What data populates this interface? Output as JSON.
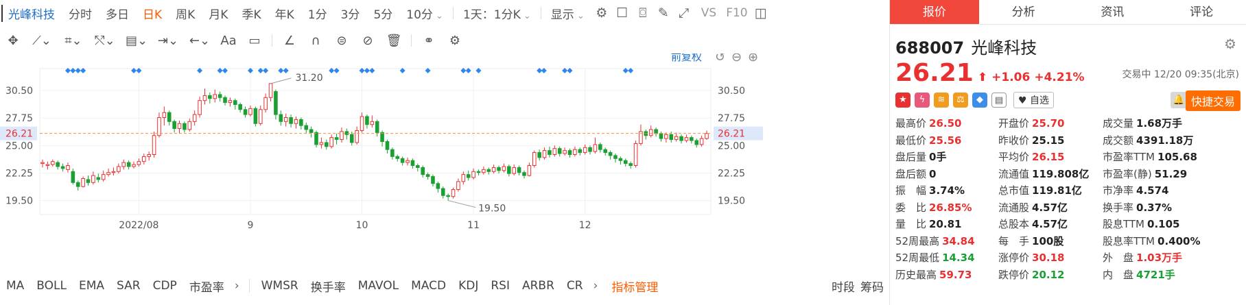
{
  "toolbar": {
    "stock_name": "光峰科技",
    "periods": [
      "分时",
      "多日",
      "日K",
      "周K",
      "月K",
      "季K",
      "年K",
      "1分",
      "3分",
      "5分",
      "10分"
    ],
    "active_period": "日K",
    "multi_select": "1天：1分K",
    "display_label": "显示",
    "vs_label": "VS",
    "f10_label": "F10"
  },
  "chart": {
    "adjust_label": "前复权",
    "current_price_label": "26.21",
    "high_marker": "31.20",
    "low_marker": "19.50",
    "y_ticks": [
      "30.50",
      "27.75",
      "25.00",
      "22.25",
      "19.50"
    ],
    "x_labels": [
      "2022/08",
      "9",
      "10",
      "11",
      "12"
    ]
  },
  "chart_data": {
    "type": "candlestick",
    "y_ticks": [
      30.5,
      27.75,
      25.0,
      22.25,
      19.5
    ],
    "current_price": 26.21,
    "high": 31.2,
    "low": 19.5,
    "x_labels": [
      "2022/08",
      "9",
      "10",
      "11",
      "12"
    ],
    "candles": [
      [
        23.2,
        23.3,
        22.8,
        23.6
      ],
      [
        23.0,
        23.1,
        22.6,
        23.4
      ],
      [
        23.1,
        23.4,
        22.9,
        23.6
      ],
      [
        23.3,
        22.9,
        22.6,
        23.5
      ],
      [
        22.9,
        22.7,
        22.4,
        23.2
      ],
      [
        22.6,
        23.0,
        22.3,
        23.3
      ],
      [
        22.4,
        21.3,
        21.1,
        22.7
      ],
      [
        21.3,
        20.9,
        20.5,
        21.5
      ],
      [
        20.9,
        21.7,
        20.8,
        21.9
      ],
      [
        21.6,
        21.3,
        21.0,
        22.0
      ],
      [
        21.3,
        22.0,
        21.1,
        22.4
      ],
      [
        21.8,
        21.6,
        21.3,
        22.2
      ],
      [
        21.6,
        22.1,
        21.4,
        22.5
      ],
      [
        22.1,
        22.3,
        21.9,
        22.7
      ],
      [
        22.3,
        22.4,
        22.0,
        22.8
      ],
      [
        22.4,
        22.9,
        22.2,
        23.2
      ],
      [
        22.9,
        23.3,
        22.6,
        23.6
      ],
      [
        23.3,
        22.9,
        22.6,
        23.5
      ],
      [
        22.9,
        23.1,
        22.7,
        23.4
      ],
      [
        23.1,
        23.4,
        22.9,
        23.7
      ],
      [
        23.4,
        23.9,
        23.1,
        24.2
      ],
      [
        23.9,
        24.1,
        23.5,
        24.4
      ],
      [
        24.1,
        26.0,
        23.8,
        26.4
      ],
      [
        26.0,
        27.8,
        25.8,
        28.3
      ],
      [
        27.8,
        28.3,
        27.0,
        28.9
      ],
      [
        28.3,
        27.4,
        27.0,
        28.5
      ],
      [
        27.4,
        26.7,
        26.3,
        27.6
      ],
      [
        26.7,
        27.2,
        26.2,
        27.5
      ],
      [
        27.2,
        26.6,
        26.3,
        27.4
      ],
      [
        26.6,
        27.4,
        26.4,
        27.7
      ],
      [
        27.4,
        28.1,
        27.0,
        28.5
      ],
      [
        28.1,
        29.5,
        27.8,
        29.9
      ],
      [
        29.5,
        30.0,
        29.1,
        30.7
      ],
      [
        30.0,
        29.7,
        29.2,
        30.3
      ],
      [
        29.7,
        30.1,
        29.3,
        30.6
      ],
      [
        30.1,
        29.8,
        29.4,
        30.4
      ],
      [
        29.8,
        29.3,
        29.0,
        30.0
      ],
      [
        29.3,
        29.5,
        28.9,
        29.8
      ],
      [
        29.5,
        29.1,
        28.6,
        29.7
      ],
      [
        29.1,
        28.6,
        28.3,
        29.3
      ],
      [
        28.6,
        28.1,
        27.8,
        28.9
      ],
      [
        28.1,
        28.7,
        27.9,
        29.0
      ],
      [
        28.7,
        27.2,
        26.9,
        28.9
      ],
      [
        27.2,
        28.6,
        27.0,
        29.0
      ],
      [
        28.6,
        29.8,
        28.3,
        30.2
      ],
      [
        29.8,
        31.2,
        29.4,
        31.2
      ],
      [
        30.4,
        28.1,
        27.6,
        30.6
      ],
      [
        28.1,
        27.4,
        27.0,
        28.5
      ],
      [
        27.4,
        27.8,
        26.9,
        28.2
      ],
      [
        27.8,
        27.2,
        26.8,
        28.1
      ],
      [
        27.2,
        27.6,
        26.7,
        27.9
      ],
      [
        27.6,
        27.0,
        26.6,
        27.8
      ],
      [
        27.0,
        26.6,
        26.2,
        27.3
      ],
      [
        26.6,
        26.3,
        25.8,
        26.9
      ],
      [
        26.3,
        25.1,
        24.8,
        26.5
      ],
      [
        25.1,
        25.3,
        24.7,
        25.8
      ],
      [
        25.3,
        24.9,
        24.6,
        25.6
      ],
      [
        24.9,
        25.8,
        24.7,
        26.1
      ],
      [
        25.8,
        25.6,
        25.1,
        26.2
      ],
      [
        25.6,
        26.4,
        25.3,
        26.8
      ],
      [
        26.4,
        26.1,
        25.6,
        26.7
      ],
      [
        26.1,
        25.3,
        25.0,
        26.4
      ],
      [
        25.3,
        26.5,
        25.1,
        26.9
      ],
      [
        26.5,
        27.9,
        26.3,
        28.3
      ],
      [
        27.9,
        27.1,
        26.7,
        28.1
      ],
      [
        27.1,
        27.4,
        26.8,
        28.0
      ],
      [
        27.4,
        26.3,
        25.9,
        27.6
      ],
      [
        26.3,
        25.4,
        24.9,
        26.5
      ],
      [
        25.4,
        24.6,
        24.2,
        25.6
      ],
      [
        24.6,
        23.9,
        23.6,
        24.8
      ],
      [
        23.9,
        23.7,
        23.4,
        24.1
      ],
      [
        23.7,
        23.3,
        23.0,
        23.9
      ],
      [
        23.3,
        23.5,
        23.0,
        23.8
      ],
      [
        23.5,
        23.0,
        22.7,
        23.7
      ],
      [
        23.0,
        22.8,
        22.4,
        23.2
      ],
      [
        22.8,
        22.1,
        21.8,
        23.0
      ],
      [
        22.1,
        21.9,
        21.6,
        22.3
      ],
      [
        21.9,
        21.2,
        20.9,
        22.1
      ],
      [
        21.2,
        20.7,
        20.3,
        21.4
      ],
      [
        20.7,
        20.0,
        19.7,
        20.9
      ],
      [
        20.0,
        19.9,
        19.5,
        20.2
      ],
      [
        19.9,
        20.6,
        19.7,
        20.8
      ],
      [
        20.6,
        21.4,
        20.4,
        21.7
      ],
      [
        21.4,
        22.1,
        21.1,
        22.4
      ],
      [
        22.1,
        21.8,
        21.5,
        22.5
      ],
      [
        21.8,
        22.4,
        21.6,
        22.7
      ],
      [
        22.4,
        22.3,
        22.0,
        22.6
      ],
      [
        22.3,
        22.6,
        22.1,
        22.9
      ],
      [
        22.6,
        22.4,
        22.1,
        22.8
      ],
      [
        22.4,
        22.8,
        22.2,
        23.1
      ],
      [
        22.8,
        22.5,
        22.2,
        23.0
      ],
      [
        22.5,
        22.9,
        22.3,
        23.2
      ],
      [
        22.9,
        22.2,
        21.9,
        23.1
      ],
      [
        22.2,
        22.8,
        22.0,
        23.1
      ],
      [
        22.8,
        22.3,
        22.0,
        23.0
      ],
      [
        22.3,
        22.0,
        21.7,
        22.5
      ],
      [
        22.0,
        23.0,
        21.9,
        23.3
      ],
      [
        23.0,
        24.3,
        22.8,
        24.5
      ],
      [
        24.3,
        23.8,
        23.5,
        24.6
      ],
      [
        23.8,
        24.5,
        23.6,
        24.8
      ],
      [
        24.5,
        24.1,
        23.8,
        24.9
      ],
      [
        24.1,
        24.7,
        23.9,
        25.0
      ],
      [
        24.7,
        24.2,
        23.9,
        24.9
      ],
      [
        24.2,
        24.5,
        24.0,
        24.8
      ],
      [
        24.5,
        24.1,
        23.8,
        24.7
      ],
      [
        24.1,
        24.6,
        23.9,
        24.9
      ],
      [
        24.6,
        24.3,
        24.0,
        24.8
      ],
      [
        24.3,
        24.8,
        24.1,
        25.1
      ],
      [
        24.8,
        24.4,
        24.1,
        25.0
      ],
      [
        24.4,
        25.1,
        24.2,
        25.8
      ],
      [
        25.1,
        24.6,
        24.3,
        25.3
      ],
      [
        24.6,
        24.3,
        24.0,
        24.8
      ],
      [
        24.3,
        24.0,
        23.6,
        24.5
      ],
      [
        24.0,
        23.7,
        23.3,
        24.2
      ],
      [
        23.7,
        23.5,
        23.1,
        23.9
      ],
      [
        23.5,
        23.2,
        22.9,
        23.7
      ],
      [
        23.2,
        23.0,
        22.7,
        23.4
      ],
      [
        23.0,
        25.2,
        22.8,
        25.5
      ],
      [
        25.2,
        26.4,
        25.0,
        27.1
      ],
      [
        26.4,
        26.0,
        25.6,
        26.6
      ],
      [
        26.0,
        26.6,
        25.8,
        27.0
      ],
      [
        26.6,
        26.2,
        25.9,
        26.8
      ],
      [
        26.2,
        25.7,
        25.4,
        26.4
      ],
      [
        25.7,
        26.1,
        25.3,
        26.3
      ],
      [
        26.1,
        25.6,
        25.3,
        26.4
      ],
      [
        25.6,
        25.9,
        25.4,
        26.3
      ],
      [
        25.9,
        25.5,
        25.2,
        26.1
      ],
      [
        25.5,
        25.8,
        25.3,
        26.1
      ],
      [
        25.8,
        25.5,
        25.2,
        26.0
      ],
      [
        25.5,
        25.1,
        24.8,
        25.7
      ],
      [
        25.1,
        25.7,
        24.9,
        26.0
      ],
      [
        25.7,
        26.21,
        25.56,
        26.5
      ]
    ]
  },
  "indicators": {
    "items": [
      "MA",
      "BOLL",
      "EMA",
      "SAR",
      "CDP",
      "市盈率"
    ],
    "items2": [
      "WMSR",
      "换手率",
      "MAVOL",
      "MACD",
      "KDJ",
      "RSI",
      "ARBR",
      "CR"
    ],
    "manager": "指标管理",
    "right_items": [
      "时段",
      "筹码"
    ]
  },
  "panel": {
    "tabs": [
      "报价",
      "分析",
      "资讯",
      "评论"
    ],
    "active_tab": "报价",
    "code": "688007",
    "name": "光峰科技",
    "price": "26.21",
    "change": "+1.06",
    "change_pct": "+4.21%",
    "status": "交易中 12/20 09:35(北京)",
    "watch_label": "自选",
    "quick_trade": "快捷交易",
    "stats": [
      {
        "k": "最高价",
        "v": "26.50",
        "c": "red"
      },
      {
        "k": "开盘价",
        "v": "25.70",
        "c": "red"
      },
      {
        "k": "成交量",
        "v": "1.68万手",
        "c": "dark"
      },
      {
        "k": "最低价",
        "v": "25.56",
        "c": "red"
      },
      {
        "k": "昨收价",
        "v": "25.15",
        "c": "dark"
      },
      {
        "k": "成交额",
        "v": "4391.18万",
        "c": "dark"
      },
      {
        "k": "盘后量",
        "v": "0手",
        "c": "dark"
      },
      {
        "k": "平均价",
        "v": "26.15",
        "c": "red"
      },
      {
        "k": "市盈率TTM",
        "v": "105.68",
        "c": "dark"
      },
      {
        "k": "盘后额",
        "v": "0",
        "c": "dark"
      },
      {
        "k": "流通值",
        "v": "119.808亿",
        "c": "dark"
      },
      {
        "k": "市盈率(静)",
        "v": "51.29",
        "c": "dark"
      },
      {
        "k": "振　幅",
        "v": "3.74%",
        "c": "dark"
      },
      {
        "k": "总市值",
        "v": "119.81亿",
        "c": "dark"
      },
      {
        "k": "市净率",
        "v": "4.574",
        "c": "dark"
      },
      {
        "k": "委　比",
        "v": "26.85%",
        "c": "red"
      },
      {
        "k": "流通股",
        "v": "4.57亿",
        "c": "dark"
      },
      {
        "k": "换手率",
        "v": "0.37%",
        "c": "dark"
      },
      {
        "k": "量　比",
        "v": "20.81",
        "c": "dark"
      },
      {
        "k": "总股本",
        "v": "4.57亿",
        "c": "dark"
      },
      {
        "k": "股息TTM",
        "v": "0.105",
        "c": "dark"
      },
      {
        "k": "52周最高",
        "v": "34.84",
        "c": "red"
      },
      {
        "k": "每　手",
        "v": "100股",
        "c": "dark"
      },
      {
        "k": "股息率TTM",
        "v": "0.400%",
        "c": "dark"
      },
      {
        "k": "52周最低",
        "v": "14.34",
        "c": "green"
      },
      {
        "k": "涨停价",
        "v": "30.18",
        "c": "red"
      },
      {
        "k": "外　盘",
        "v": "1.03万手",
        "c": "red"
      },
      {
        "k": "历史最高",
        "v": "59.73",
        "c": "red"
      },
      {
        "k": "跌停价",
        "v": "20.12",
        "c": "green"
      },
      {
        "k": "内　盘",
        "v": "4721手",
        "c": "green"
      }
    ]
  }
}
